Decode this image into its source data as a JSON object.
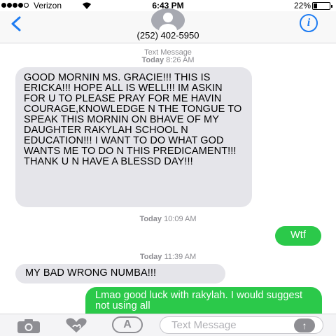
{
  "status_bar": {
    "carrier": "Verizon",
    "time": "6:43 PM",
    "battery": "22%"
  },
  "header": {
    "contact_number": "(252) 402-5950",
    "info_label": "i"
  },
  "thread": {
    "first_meta": {
      "label": "Text Message",
      "day": "Today",
      "time": "8:26 AM"
    },
    "messages": [
      {
        "direction": "incoming",
        "text": "GOOD MORNIN MS. GRACIE!!! THIS IS ERICKA!!! HOPE ALL IS WELL!!! IM ASKIN FOR U TO PLEASE PRAY FOR ME HAVIN COURAGE,KNOWLEDGE N THE TONGUE TO SPEAK THIS MORNIN ON BHAVE OF MY DAUGHTER RAKYLAH SCHOOL N EDUCATION!!! I WANT TO DO WHAT GOD WANTS ME TO DO N THIS PREDICAMENT!!! THANK U N HAVE A BLESSD DAY!!!"
      },
      {
        "direction": "outgoing",
        "text": "Wtf"
      },
      {
        "direction": "incoming",
        "text": "MY BAD WRONG NUMBA!!!"
      },
      {
        "direction": "outgoing",
        "text": "Lmao good luck with rakylah. I would suggest not using all"
      }
    ],
    "meta_2": {
      "day": "Today",
      "time": "10:09 AM"
    },
    "meta_3": {
      "day": "Today",
      "time": "11:39 AM"
    }
  },
  "composer": {
    "placeholder": "Text Message",
    "apps_label": "A",
    "send_label": "↑"
  },
  "icons": {
    "back": "chevron-left-icon",
    "info": "info-icon",
    "camera": "camera-icon",
    "digital_touch": "heart-hand-icon",
    "apps": "app-store-icon",
    "send": "arrow-up-icon"
  },
  "colors": {
    "accent": "#1e7cf2",
    "outgoing_bubble": "#2bc94a",
    "incoming_bubble": "#e5e5ea"
  }
}
